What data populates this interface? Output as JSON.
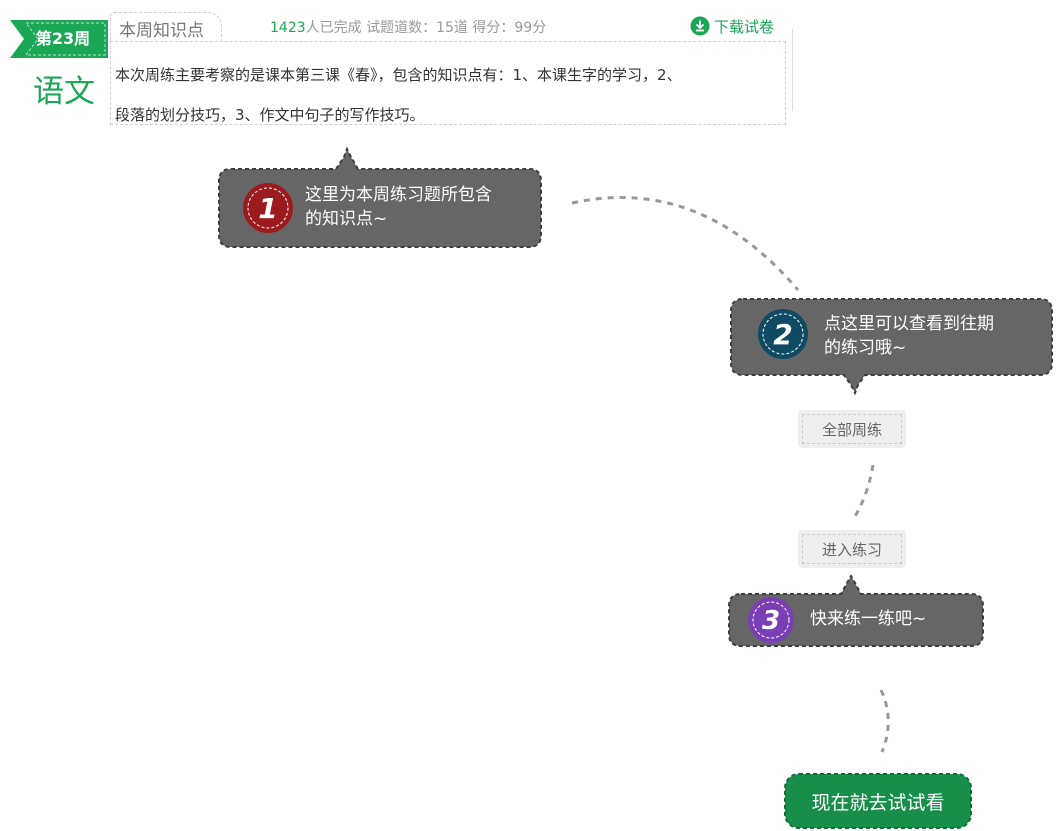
{
  "header": {
    "week_label": "第23周",
    "subject": "语文",
    "tab_label": "本周知识点",
    "stats": {
      "completed_count": "1423",
      "completed_suffix": "人已完成",
      "question_count_text": "试题道数：15道",
      "score_text": "得分：99分"
    },
    "download_label": "下载试卷",
    "description_line1": "本次周练主要考察的是课本第三课《春》，包含的知识点有：1、本课生字的学习，2、",
    "description_line2": "段落的划分技巧，3、作文中句子的写作技巧。"
  },
  "guide": {
    "step1": {
      "number": "1",
      "text_line1": "这里为本周练习题所包含",
      "text_line2": "的知识点~",
      "badge_color": "#9b1b1e"
    },
    "step2": {
      "number": "2",
      "text_line1": "点这里可以查看到往期",
      "text_line2": "的练习哦~",
      "badge_color": "#0e4a63"
    },
    "step3": {
      "number": "3",
      "text_line1": "快来练一练吧~",
      "badge_color": "#7b3fb5"
    }
  },
  "buttons": {
    "all_weekly": "全部周练",
    "enter_practice": "进入练习",
    "try_now": "现在就去试试看"
  },
  "colors": {
    "brand_green": "#1aa856",
    "cta_green": "#178f4a",
    "tooltip_gray": "#666666"
  }
}
